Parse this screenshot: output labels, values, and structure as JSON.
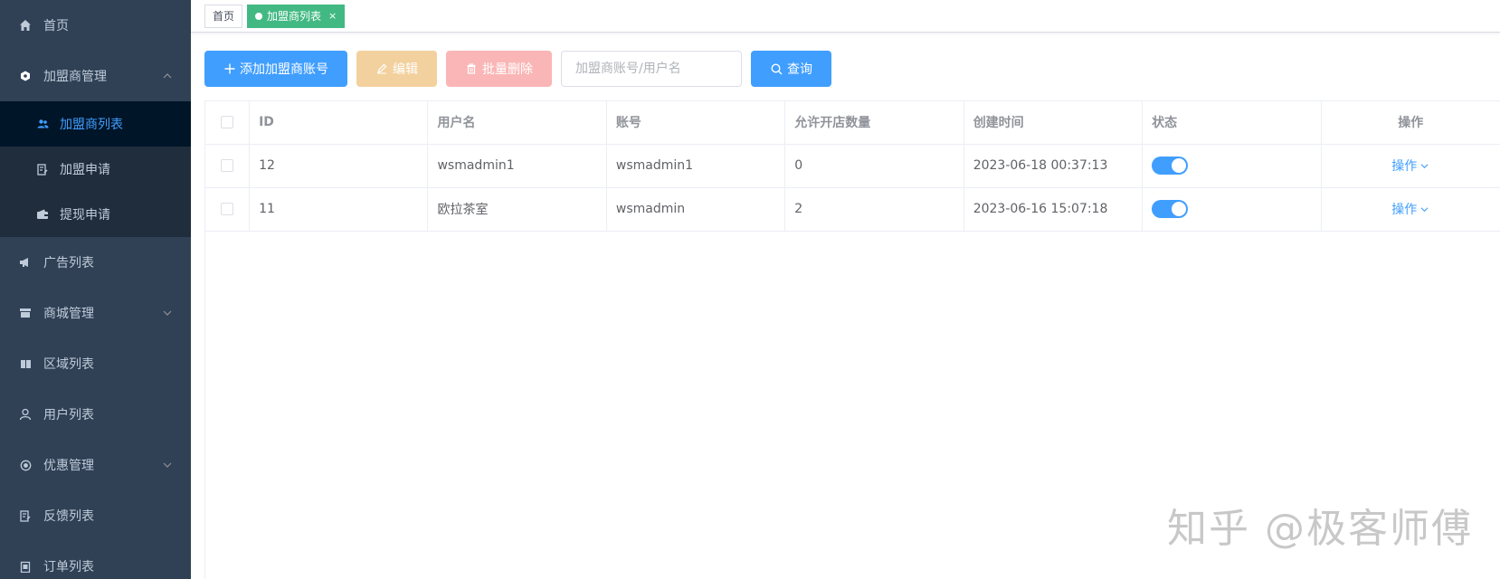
{
  "sidebar": {
    "items": [
      {
        "label": "首页",
        "icon": "home-icon"
      },
      {
        "label": "加盟商管理",
        "icon": "hexagon-icon",
        "expanded": true,
        "children": [
          {
            "label": "加盟商列表",
            "icon": "users-icon",
            "active": true
          },
          {
            "label": "加盟申请",
            "icon": "edit-doc-icon"
          },
          {
            "label": "提现申请",
            "icon": "wallet-icon"
          }
        ]
      },
      {
        "label": "广告列表",
        "icon": "megaphone-icon"
      },
      {
        "label": "商城管理",
        "icon": "shop-icon"
      },
      {
        "label": "区域列表",
        "icon": "book-icon"
      },
      {
        "label": "用户列表",
        "icon": "user-icon"
      },
      {
        "label": "优惠管理",
        "icon": "coupon-icon"
      },
      {
        "label": "反馈列表",
        "icon": "edit-doc-icon"
      },
      {
        "label": "订单列表",
        "icon": "clipboard-icon"
      }
    ]
  },
  "tags": {
    "home": "首页",
    "current": "加盟商列表",
    "close": "×"
  },
  "toolbar": {
    "add_label": "添加加盟商账号",
    "edit_label": "编辑",
    "batch_delete_label": "批量删除",
    "search_placeholder": "加盟商账号/用户名",
    "search_value": "",
    "query_label": "查询"
  },
  "table": {
    "columns": [
      "ID",
      "用户名",
      "账号",
      "允许开店数量",
      "创建时间",
      "状态",
      "操作"
    ],
    "rows": [
      {
        "id": "12",
        "username": "wsmadmin1",
        "account": "wsmadmin1",
        "shop_count": "0",
        "created": "2023-06-18 00:37:13",
        "status": true,
        "action": "操作"
      },
      {
        "id": "11",
        "username": "欧拉茶室",
        "account": "wsmadmin",
        "shop_count": "2",
        "created": "2023-06-16 15:07:18",
        "status": true,
        "action": "操作"
      }
    ]
  },
  "watermark": "知乎 @极客师傅",
  "colors": {
    "sidebar_bg": "#304156",
    "submenu_bg": "#1f2d3d",
    "active_bg": "#001528",
    "primary": "#409eff",
    "tag_active": "#42b983"
  }
}
